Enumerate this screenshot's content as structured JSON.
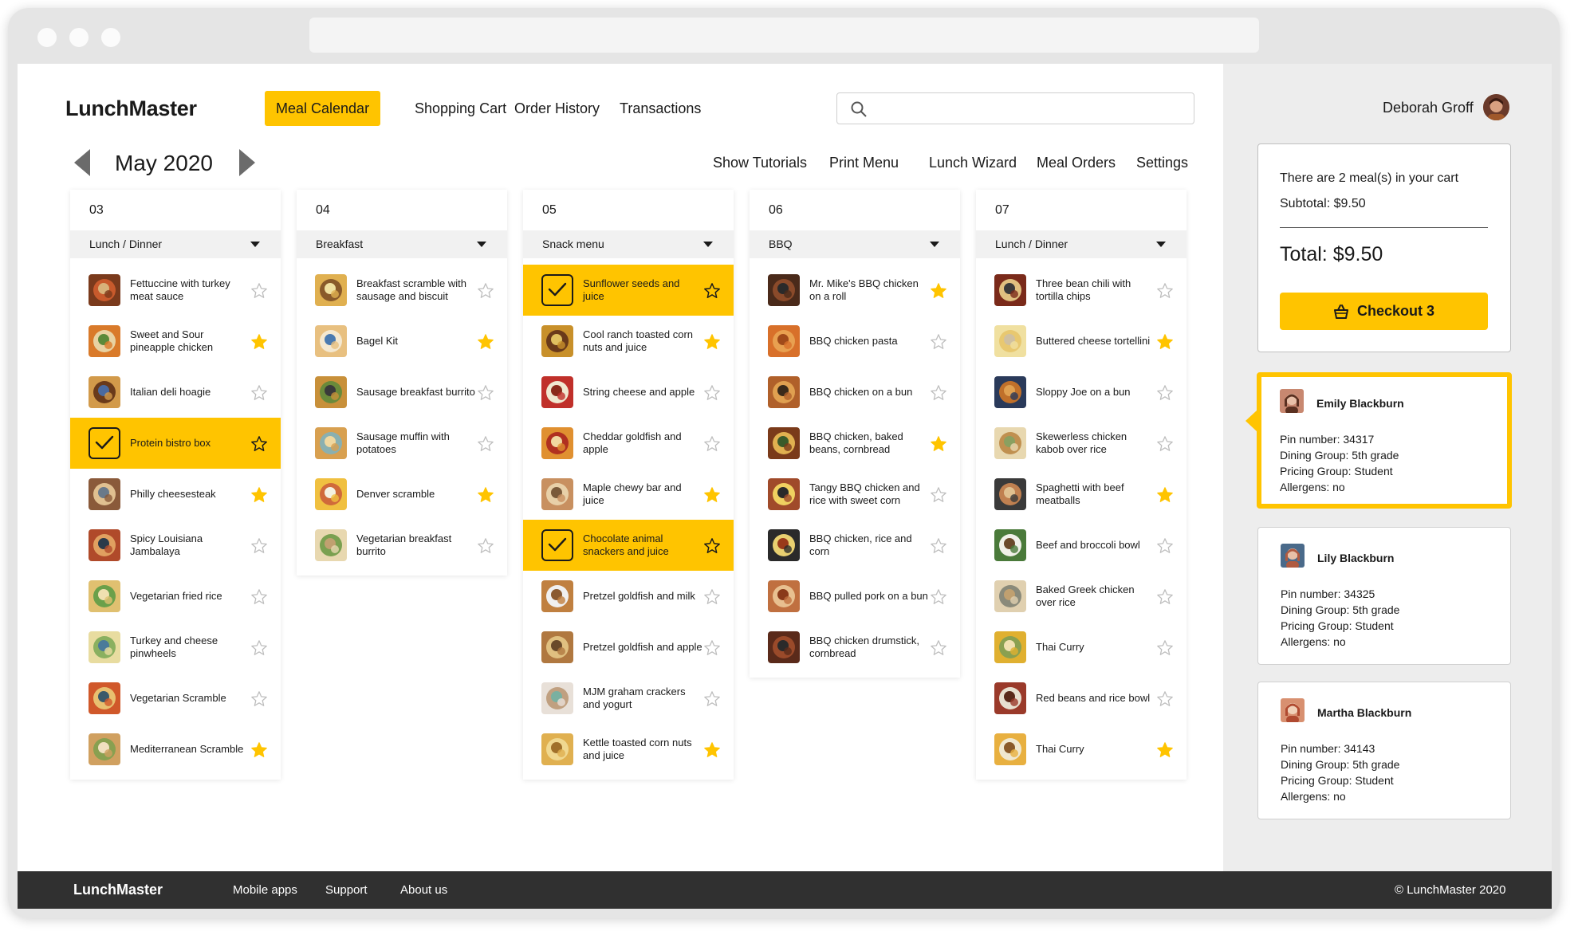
{
  "app": {
    "name": "LunchMaster"
  },
  "nav": {
    "tabs": [
      "Meal Calendar",
      "Shopping Cart",
      "Order History",
      "Transactions"
    ],
    "active": "Meal Calendar"
  },
  "search": {
    "placeholder": ""
  },
  "calendar": {
    "month": "May 2020"
  },
  "tools": [
    "Show Tutorials",
    "Print Menu",
    "Lunch Wizard",
    "Meal Orders",
    "Settings"
  ],
  "user": {
    "name": "Deborah Groff"
  },
  "days": [
    {
      "date": "03",
      "meal": "Lunch / Dinner",
      "items": [
        {
          "name": "Fettuccine with turkey meat sauce",
          "fav": false,
          "selected": false,
          "colors": [
            "#7a3a1c",
            "#c85a2c",
            "#d8b27a"
          ]
        },
        {
          "name": "Sweet and Sour pineapple chicken",
          "fav": true,
          "selected": false,
          "colors": [
            "#d97a2a",
            "#e8d2a2",
            "#5a8a3a"
          ]
        },
        {
          "name": "Italian deli hoagie",
          "fav": false,
          "selected": false,
          "colors": [
            "#d29a4a",
            "#6a3a1a",
            "#4a6aa0"
          ]
        },
        {
          "name": "Protein bistro box",
          "fav": false,
          "selected": true,
          "colors": []
        },
        {
          "name": "Philly cheesesteak",
          "fav": true,
          "selected": false,
          "colors": [
            "#8a5a3a",
            "#e0c090",
            "#6a7a8a"
          ]
        },
        {
          "name": "Spicy Louisiana Jambalaya",
          "fav": false,
          "selected": false,
          "colors": [
            "#b04a2a",
            "#e0a060",
            "#2a3a4a"
          ]
        },
        {
          "name": "Vegetarian fried rice",
          "fav": false,
          "selected": false,
          "colors": [
            "#e0c070",
            "#6aa04a",
            "#f0e0b0"
          ]
        },
        {
          "name": "Turkey and cheese pinwheels",
          "fav": false,
          "selected": false,
          "colors": [
            "#e8dca0",
            "#8ab060",
            "#4a7a9a"
          ]
        },
        {
          "name": "Vegetarian Scramble",
          "fav": false,
          "selected": false,
          "colors": [
            "#d0582a",
            "#e8c070",
            "#3a5a6a"
          ]
        },
        {
          "name": "Mediterranean Scramble",
          "fav": true,
          "selected": false,
          "colors": [
            "#d0a060",
            "#88a050",
            "#f0e0c0"
          ]
        }
      ]
    },
    {
      "date": "04",
      "meal": "Breakfast",
      "items": [
        {
          "name": "Breakfast scramble with sausage and biscuit",
          "fav": false,
          "selected": false,
          "colors": [
            "#e0b050",
            "#8a5a2a",
            "#f0e0a0"
          ]
        },
        {
          "name": "Bagel Kit",
          "fav": true,
          "selected": false,
          "colors": [
            "#e8c080",
            "#f4e8d0",
            "#4a7ab0"
          ]
        },
        {
          "name": "Sausage breakfast burrito",
          "fav": false,
          "selected": false,
          "colors": [
            "#c8903a",
            "#6a8a3a",
            "#3a3a3a"
          ]
        },
        {
          "name": "Sausage muffin with potatoes",
          "fav": false,
          "selected": false,
          "colors": [
            "#d8a050",
            "#8ab0b0",
            "#f0d8a0"
          ]
        },
        {
          "name": "Denver scramble",
          "fav": true,
          "selected": false,
          "colors": [
            "#f0c040",
            "#d06a3a",
            "#f4f0e0"
          ]
        },
        {
          "name": "Vegetarian breakfast burrito",
          "fav": false,
          "selected": false,
          "colors": [
            "#e8d8b0",
            "#7aa050",
            "#c0a070"
          ]
        }
      ]
    },
    {
      "date": "05",
      "meal": "Snack menu",
      "items": [
        {
          "name": "Sunflower seeds and juice",
          "fav": false,
          "selected": true,
          "colors": []
        },
        {
          "name": "Cool ranch toasted corn nuts and juice",
          "fav": true,
          "selected": false,
          "colors": [
            "#c8902a",
            "#6a3a1a",
            "#e0c060"
          ]
        },
        {
          "name": "String cheese and apple",
          "fav": false,
          "selected": false,
          "colors": [
            "#c0302a",
            "#f0e8d0",
            "#8a2a1a"
          ]
        },
        {
          "name": "Cheddar goldfish and apple",
          "fav": false,
          "selected": false,
          "colors": [
            "#e09030",
            "#b03020",
            "#f0d8a0"
          ]
        },
        {
          "name": "Maple chewy bar and juice",
          "fav": true,
          "selected": false,
          "colors": [
            "#c89060",
            "#e8d0a8",
            "#7a5a3a"
          ]
        },
        {
          "name": "Chocolate animal snackers and juice",
          "fav": false,
          "selected": true,
          "colors": []
        },
        {
          "name": "Pretzel goldfish and milk",
          "fav": false,
          "selected": false,
          "colors": [
            "#c08040",
            "#f0f0f0",
            "#8a5a30"
          ]
        },
        {
          "name": "Pretzel goldfish and apple",
          "fav": false,
          "selected": false,
          "colors": [
            "#b07840",
            "#e0c080",
            "#6a4a2a"
          ]
        },
        {
          "name": "MJM graham crackers and yogurt",
          "fav": false,
          "selected": false,
          "colors": [
            "#e8e0d8",
            "#c0a080",
            "#7ab0a0"
          ]
        },
        {
          "name": "Kettle toasted corn nuts and juice",
          "fav": true,
          "selected": false,
          "colors": [
            "#e0b050",
            "#f0d890",
            "#a0702a"
          ]
        }
      ]
    },
    {
      "date": "06",
      "meal": "BBQ",
      "items": [
        {
          "name": "Mr. Mike's BBQ chicken on a roll",
          "fav": true,
          "selected": false,
          "colors": [
            "#4a2a1a",
            "#8a4a2a",
            "#2a2a2a"
          ]
        },
        {
          "name": "BBQ chicken pasta",
          "fav": false,
          "selected": false,
          "colors": [
            "#d8702a",
            "#e8a050",
            "#a04a1a"
          ]
        },
        {
          "name": "BBQ chicken on a bun",
          "fav": false,
          "selected": false,
          "colors": [
            "#b0602a",
            "#e0a050",
            "#3a2a1a"
          ]
        },
        {
          "name": "BBQ chicken, baked beans, cornbread",
          "fav": true,
          "selected": false,
          "colors": [
            "#7a3a1a",
            "#e0b050",
            "#3a5a2a"
          ]
        },
        {
          "name": "Tangy BBQ chicken and rice with sweet corn",
          "fav": false,
          "selected": false,
          "colors": [
            "#a04a2a",
            "#f0d060",
            "#2a2a2a"
          ]
        },
        {
          "name": "BBQ chicken, rice and corn",
          "fav": false,
          "selected": false,
          "colors": [
            "#2a2a2a",
            "#e8d070",
            "#9a3a1a"
          ]
        },
        {
          "name": "BBQ pulled pork on a bun",
          "fav": false,
          "selected": false,
          "colors": [
            "#c07040",
            "#e8c090",
            "#8a3a1a"
          ]
        },
        {
          "name": "BBQ chicken drumstick, cornbread",
          "fav": false,
          "selected": false,
          "colors": [
            "#5a2a1a",
            "#9a4a2a",
            "#2a2a2a"
          ]
        }
      ]
    },
    {
      "date": "07",
      "meal": "Lunch / Dinner",
      "items": [
        {
          "name": "Three bean chili with tortilla chips",
          "fav": false,
          "selected": false,
          "colors": [
            "#7a2a1a",
            "#e0c080",
            "#3a3a3a"
          ]
        },
        {
          "name": "Buttered cheese tortellini",
          "fav": true,
          "selected": false,
          "colors": [
            "#f0e0a0",
            "#e8c870",
            "#d0c0a0"
          ]
        },
        {
          "name": "Sloppy Joe on a bun",
          "fav": false,
          "selected": false,
          "colors": [
            "#2a3a5a",
            "#c0702a",
            "#e0a050"
          ]
        },
        {
          "name": "Skewerless chicken kabob over rice",
          "fav": false,
          "selected": false,
          "colors": [
            "#e8d8b0",
            "#c09050",
            "#8aa060"
          ]
        },
        {
          "name": "Spaghetti with beef meatballs",
          "fav": true,
          "selected": false,
          "colors": [
            "#3a3a3a",
            "#c08050",
            "#e0c090"
          ]
        },
        {
          "name": "Beef and broccoli bowl",
          "fav": false,
          "selected": false,
          "colors": [
            "#4a7a3a",
            "#f0f0e8",
            "#6a4a2a"
          ]
        },
        {
          "name": "Baked Greek chicken over rice",
          "fav": false,
          "selected": false,
          "colors": [
            "#e0d0b0",
            "#8a8a7a",
            "#c0a070"
          ]
        },
        {
          "name": "Thai Curry",
          "fav": false,
          "selected": false,
          "colors": [
            "#e0b030",
            "#8aa050",
            "#f0e0b0"
          ]
        },
        {
          "name": "Red beans and rice bowl",
          "fav": false,
          "selected": false,
          "colors": [
            "#9a3a2a",
            "#e8e0d0",
            "#5a2a1a"
          ]
        },
        {
          "name": "Thai Curry",
          "fav": true,
          "selected": false,
          "colors": [
            "#e8b040",
            "#f0e8d0",
            "#8a5a2a"
          ]
        }
      ]
    }
  ],
  "cart": {
    "message": "There are 2 meal(s) in your cart",
    "subtotal": "Subtotal: $9.50",
    "total": "Total: $9.50",
    "checkout_label": "Checkout 3"
  },
  "students": [
    {
      "name": "Emily Blackburn",
      "pin": "Pin number: 34317",
      "dining": "Dining Group: 5th grade",
      "pricing": "Pricing Group: Student",
      "allergens": "Allergens: no",
      "active": true
    },
    {
      "name": "Lily Blackburn",
      "pin": "Pin number: 34325",
      "dining": "Dining Group: 5th grade",
      "pricing": "Pricing Group: Student",
      "allergens": "Allergens: no",
      "active": false
    },
    {
      "name": "Martha Blackburn",
      "pin": "Pin number: 34143",
      "dining": "Dining Group: 5th grade",
      "pricing": "Pricing Group: Student",
      "allergens": "Allergens: no",
      "active": false
    }
  ],
  "footer": {
    "logo": "LunchMaster",
    "links": [
      "Mobile apps",
      "Support",
      "About us"
    ],
    "copyright": "© LunchMaster 2020"
  },
  "colors": {
    "accent": "#ffc400",
    "footer_bg": "#303030",
    "star": "#ffc400",
    "star_outline": "#bdbdbd"
  },
  "icons": {
    "search": "search-icon",
    "basket": "basket-icon",
    "star": "star-icon",
    "check": "check-icon",
    "prev": "chevron-left-icon",
    "next": "chevron-right-icon"
  }
}
